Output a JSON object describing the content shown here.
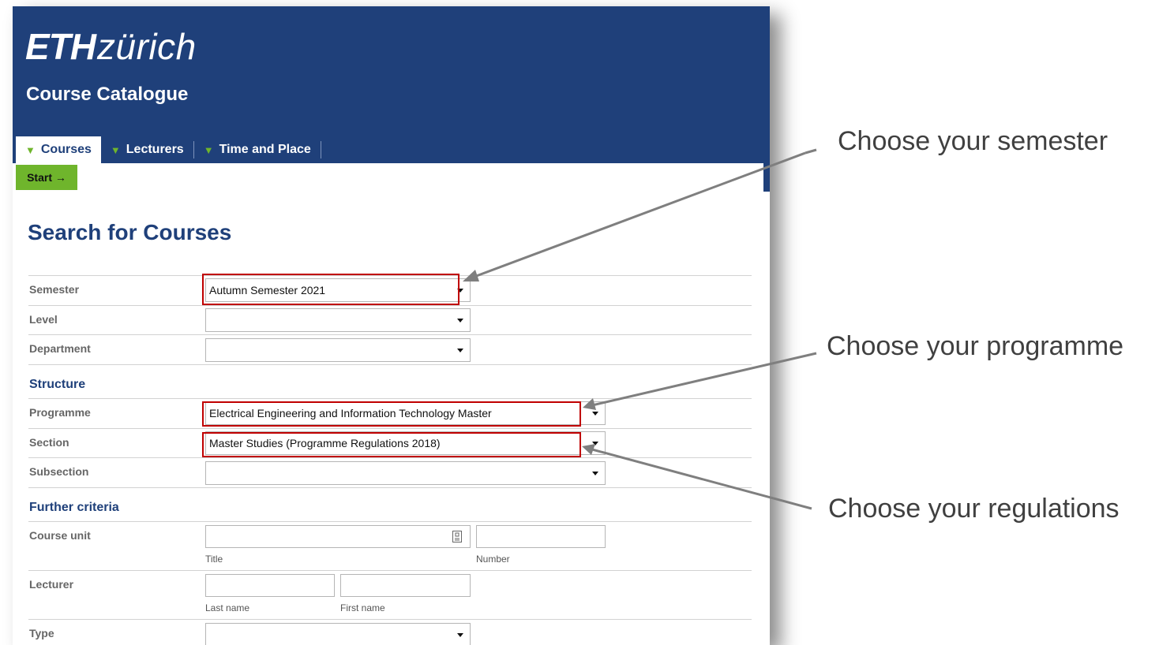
{
  "header": {
    "logo_eth": "ETH",
    "logo_zurich": "zürich",
    "catalogue_title": "Course Catalogue"
  },
  "tabs": [
    {
      "label": "Courses",
      "active": true
    },
    {
      "label": "Lecturers",
      "active": false
    },
    {
      "label": "Time and Place",
      "active": false
    }
  ],
  "start_button": "Start →",
  "page_title": "Search for Courses",
  "form": {
    "semester": {
      "label": "Semester",
      "value": "Autumn Semester 2021"
    },
    "level": {
      "label": "Level",
      "value": ""
    },
    "department": {
      "label": "Department",
      "value": ""
    },
    "structure_heading": "Structure",
    "programme": {
      "label": "Programme",
      "value": "Electrical Engineering and Information Technology Master"
    },
    "section": {
      "label": "Section",
      "value": "Master Studies (Programme Regulations 2018)"
    },
    "subsection": {
      "label": "Subsection",
      "value": ""
    },
    "further_heading": "Further criteria",
    "course_unit": {
      "label": "Course unit",
      "title_hint": "Title",
      "number_hint": "Number"
    },
    "lecturer": {
      "label": "Lecturer",
      "last_hint": "Last name",
      "first_hint": "First name"
    },
    "type": {
      "label": "Type",
      "value": ""
    }
  },
  "callouts": {
    "semester": "Choose your semester",
    "programme": "Choose your programme",
    "regulations": "Choose your regulations"
  },
  "colors": {
    "eth_blue": "#1f407a",
    "eth_green": "#6fb52c",
    "highlight_red": "#c00000"
  }
}
